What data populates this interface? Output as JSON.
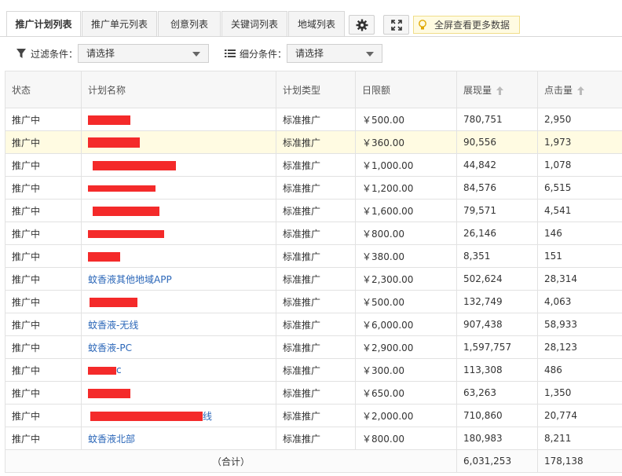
{
  "tabs": [
    {
      "label": "推广计划列表",
      "active": true
    },
    {
      "label": "推广单元列表",
      "active": false
    },
    {
      "label": "创意列表",
      "active": false
    },
    {
      "label": "关键词列表",
      "active": false
    },
    {
      "label": "地域列表",
      "active": false
    }
  ],
  "toolbar": {
    "settings_icon": "gear-icon",
    "fullscreen_icon": "expand-icon",
    "tip_text": "全屏查看更多数据"
  },
  "filters": {
    "filter_label": "过滤条件：",
    "filter_value": "请选择",
    "segment_label": "细分条件：",
    "segment_value": "请选择"
  },
  "table": {
    "columns": [
      "状态",
      "计划名称",
      "计划类型",
      "日限额",
      "展现量",
      "点击量"
    ],
    "rows": [
      {
        "status": "推广中",
        "name": "",
        "type": "标准推广",
        "budget": "￥500.00",
        "impressions": "780,751",
        "clicks": "2,950"
      },
      {
        "status": "推广中",
        "name": "",
        "type": "标准推广",
        "budget": "￥360.00",
        "impressions": "90,556",
        "clicks": "1,973"
      },
      {
        "status": "推广中",
        "name": "",
        "type": "标准推广",
        "budget": "￥1,000.00",
        "impressions": "44,842",
        "clicks": "1,078"
      },
      {
        "status": "推广中",
        "name": "",
        "type": "标准推广",
        "budget": "￥1,200.00",
        "impressions": "84,576",
        "clicks": "6,515"
      },
      {
        "status": "推广中",
        "name": "",
        "type": "标准推广",
        "budget": "￥1,600.00",
        "impressions": "79,571",
        "clicks": "4,541"
      },
      {
        "status": "推广中",
        "name": "",
        "type": "标准推广",
        "budget": "￥800.00",
        "impressions": "26,146",
        "clicks": "146"
      },
      {
        "status": "推广中",
        "name": "",
        "type": "标准推广",
        "budget": "￥380.00",
        "impressions": "8,351",
        "clicks": "151"
      },
      {
        "status": "推广中",
        "name": "蚊香液其他地域APP",
        "type": "标准推广",
        "budget": "￥2,300.00",
        "impressions": "502,624",
        "clicks": "28,314"
      },
      {
        "status": "推广中",
        "name": "",
        "type": "标准推广",
        "budget": "￥500.00",
        "impressions": "132,749",
        "clicks": "4,063"
      },
      {
        "status": "推广中",
        "name": "蚊香液-无线",
        "type": "标准推广",
        "budget": "￥6,000.00",
        "impressions": "907,438",
        "clicks": "58,933"
      },
      {
        "status": "推广中",
        "name": "蚊香液-PC",
        "type": "标准推广",
        "budget": "￥2,900.00",
        "impressions": "1,597,757",
        "clicks": "28,123"
      },
      {
        "status": "推广中",
        "name": "c",
        "type": "标准推广",
        "budget": "￥300.00",
        "impressions": "113,308",
        "clicks": "486"
      },
      {
        "status": "推广中",
        "name": "",
        "type": "标准推广",
        "budget": "￥650.00",
        "impressions": "63,263",
        "clicks": "1,350"
      },
      {
        "status": "推广中",
        "name": "线",
        "type": "标准推广",
        "budget": "￥2,000.00",
        "impressions": "710,860",
        "clicks": "20,774"
      },
      {
        "status": "推广中",
        "name": "蚊香液北部",
        "type": "标准推广",
        "budget": "￥800.00",
        "impressions": "180,983",
        "clicks": "8,211"
      }
    ],
    "total": {
      "label": "（合计）",
      "impressions": "6,031,253",
      "clicks": "178,138"
    }
  },
  "colors": {
    "link": "#2a66b8",
    "highlight_row": "#fffbe2",
    "redaction": "#f42a2a"
  }
}
